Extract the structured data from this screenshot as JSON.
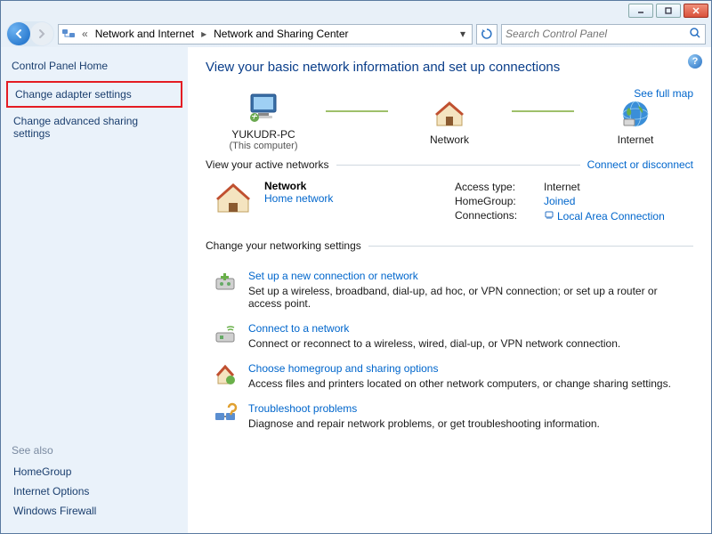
{
  "breadcrumb": {
    "lvl1": "Network and Internet",
    "lvl2": "Network and Sharing Center"
  },
  "search": {
    "placeholder": "Search Control Panel"
  },
  "sidebar": {
    "home": "Control Panel Home",
    "links": [
      "Change adapter settings",
      "Change advanced sharing settings"
    ],
    "seealso_title": "See also",
    "seealso": [
      "HomeGroup",
      "Internet Options",
      "Windows Firewall"
    ]
  },
  "heading": "View your basic network information and set up connections",
  "fullmap": "See full map",
  "nodes": {
    "pc": "YUKUDR-PC",
    "pc_sub": "(This computer)",
    "net": "Network",
    "inet": "Internet"
  },
  "active": {
    "hdr": "View your active networks",
    "rlink": "Connect or disconnect",
    "name": "Network",
    "type": "Home network",
    "rows": {
      "access_k": "Access type:",
      "access_v": "Internet",
      "hg_k": "HomeGroup:",
      "hg_v": "Joined",
      "conn_k": "Connections:",
      "conn_v": "Local Area Connection"
    }
  },
  "change_hdr": "Change your networking settings",
  "options": [
    {
      "title": "Set up a new connection or network",
      "desc": "Set up a wireless, broadband, dial-up, ad hoc, or VPN connection; or set up a router or access point."
    },
    {
      "title": "Connect to a network",
      "desc": "Connect or reconnect to a wireless, wired, dial-up, or VPN network connection."
    },
    {
      "title": "Choose homegroup and sharing options",
      "desc": "Access files and printers located on other network computers, or change sharing settings."
    },
    {
      "title": "Troubleshoot problems",
      "desc": "Diagnose and repair network problems, or get troubleshooting information."
    }
  ]
}
